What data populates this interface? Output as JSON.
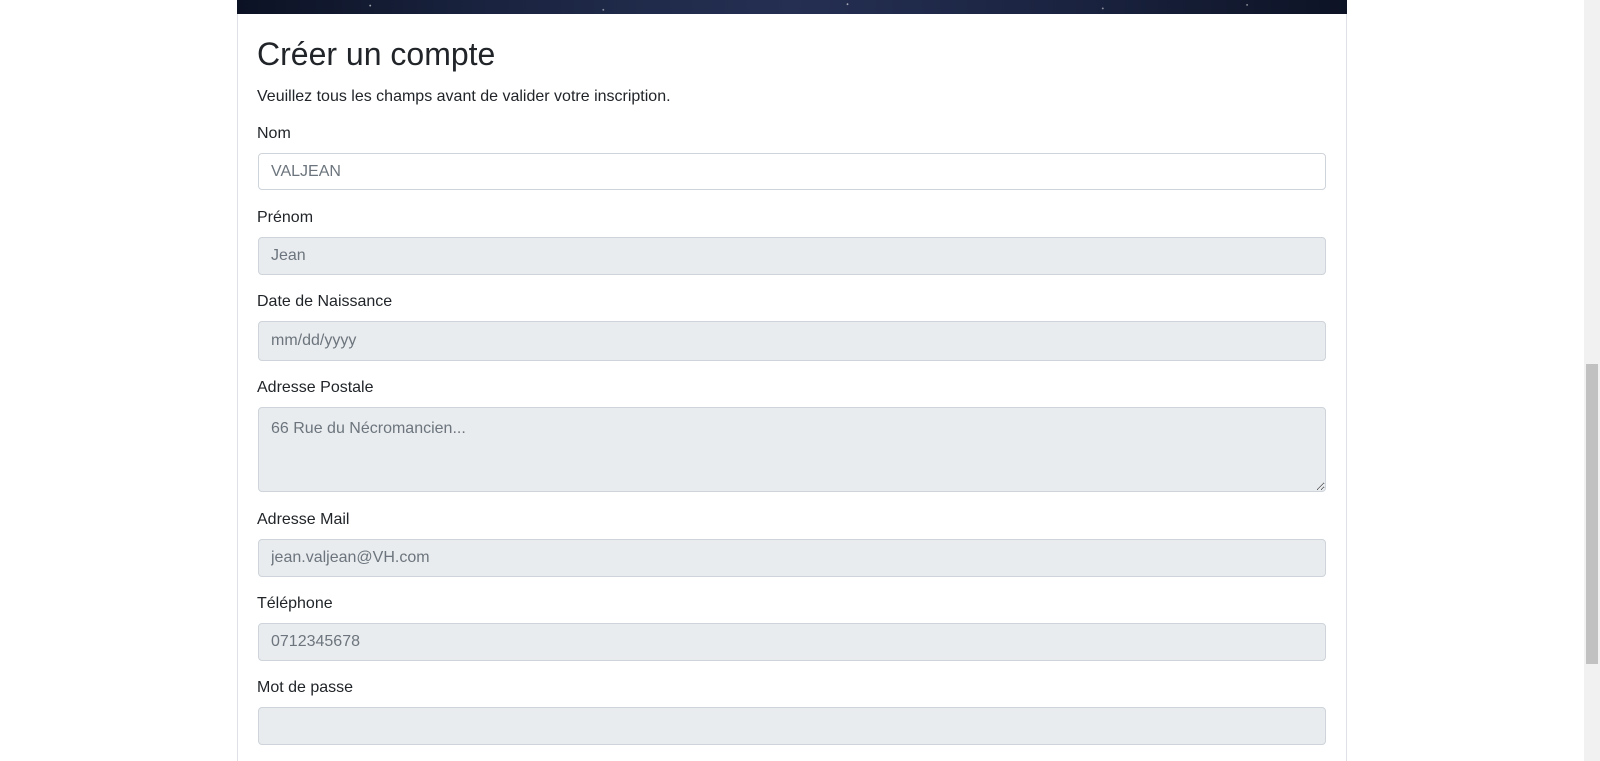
{
  "form": {
    "title": "Créer un compte",
    "subtitle": "Veuillez tous les champs avant de valider votre inscription.",
    "fields": [
      {
        "label": "Nom",
        "placeholder": "VALJEAN",
        "state": "enabled"
      },
      {
        "label": "Prénom",
        "placeholder": "Jean",
        "state": "disabled"
      },
      {
        "label": "Date de Naissance",
        "placeholder": "mm/dd/yyyy",
        "state": "disabled"
      },
      {
        "label": "Adresse Postale",
        "placeholder": "66 Rue du Nécromancien...",
        "state": "disabled"
      },
      {
        "label": "Adresse Mail",
        "placeholder": "jean.valjean@VH.com",
        "state": "disabled"
      },
      {
        "label": "Téléphone",
        "placeholder": "0712345678",
        "state": "disabled"
      },
      {
        "label": "Mot de passe",
        "placeholder": "",
        "state": "disabled"
      }
    ]
  },
  "colors": {
    "input_disabled_bg": "#e9ecef",
    "input_border": "#ced4da",
    "placeholder_text": "#6c757d",
    "text": "#212529"
  }
}
